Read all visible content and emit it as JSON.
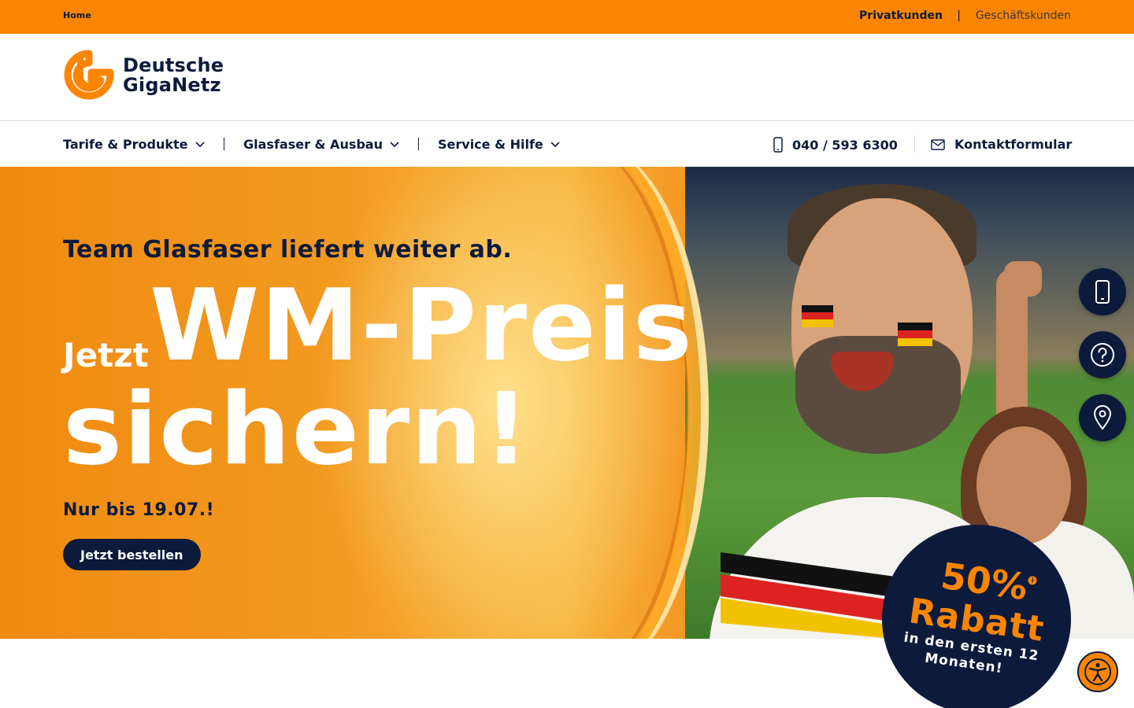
{
  "topbar": {
    "breadcrumb": "Home",
    "segment_private": "Privatkunden",
    "separator": "|",
    "segment_business": "Geschäftskunden"
  },
  "brand": {
    "line1": "Deutsche",
    "line2": "GigaNetz",
    "logo_icon": "giganetz-g-logo",
    "color": "#fb8500"
  },
  "nav": {
    "items": [
      {
        "label": "Tarife & Produkte",
        "icon": "chevron-down-icon"
      },
      {
        "label": "Glasfaser & Ausbau",
        "icon": "chevron-down-icon"
      },
      {
        "label": "Service & Hilfe",
        "icon": "chevron-down-icon"
      }
    ],
    "phone": {
      "label": "040 / 593 6300",
      "icon": "mobile-phone-icon"
    },
    "contact": {
      "label": "Kontaktformular",
      "icon": "envelope-icon"
    }
  },
  "hero": {
    "kicker": "Team Glasfaser liefert weiter ab.",
    "headline_prefix": "Jetzt",
    "headline_main": "WM-Preis",
    "headline_line2": "sichern!",
    "deadline": "Nur bis 19.07.!",
    "cta_label": "Jetzt bestellen"
  },
  "badge": {
    "percent": "50%",
    "info": "i",
    "label": "Rabatt",
    "sub_line1": "in den ersten 12",
    "sub_line2": "Monaten!"
  },
  "side_actions": [
    {
      "icon": "mobile-phone-icon"
    },
    {
      "icon": "question-icon"
    },
    {
      "icon": "map-pin-icon"
    }
  ],
  "accessibility": {
    "icon": "accessibility-icon"
  },
  "colors": {
    "accent": "#fb8500",
    "navy": "#0c1a3c"
  }
}
